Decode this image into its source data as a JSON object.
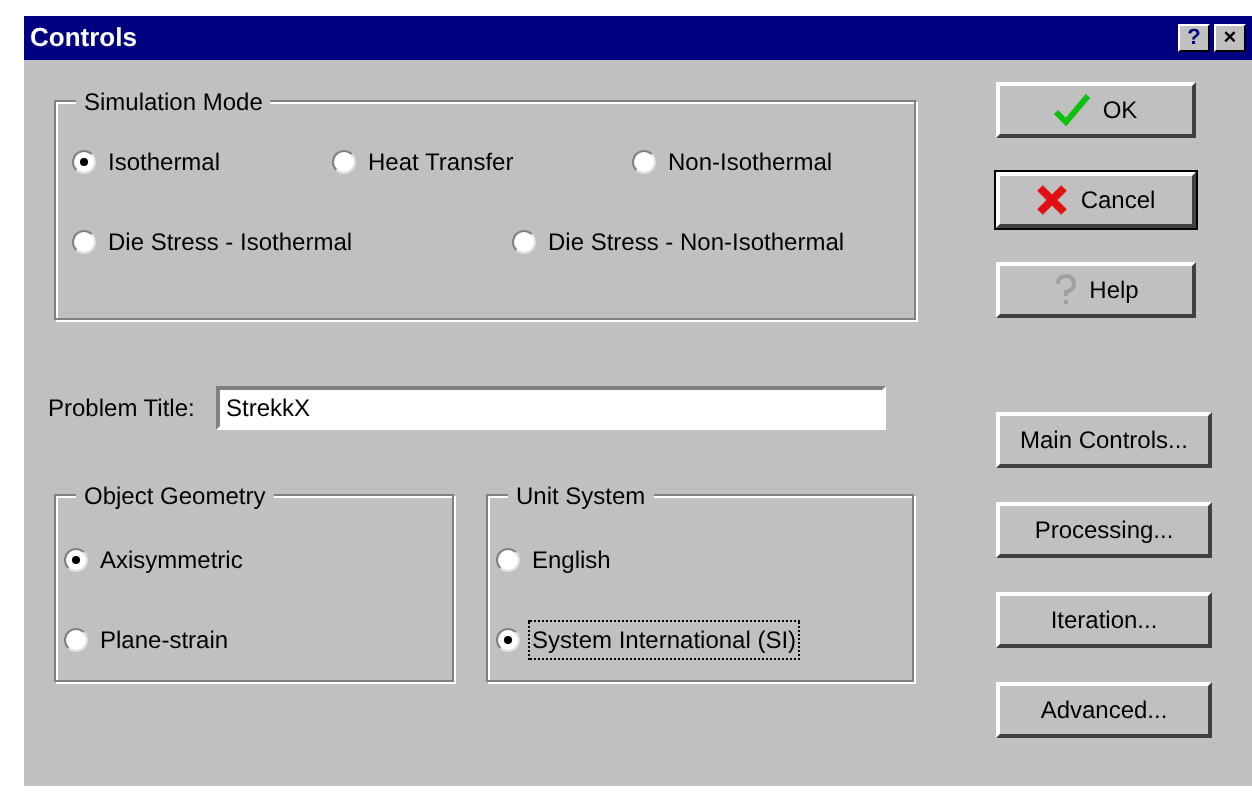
{
  "window": {
    "title": "Controls",
    "title_buttons": [
      "?",
      "×"
    ]
  },
  "simulation_mode": {
    "label": "Simulation Mode",
    "options": [
      {
        "label": "Isothermal",
        "selected": true
      },
      {
        "label": "Heat Transfer",
        "selected": false
      },
      {
        "label": "Non-Isothermal",
        "selected": false
      },
      {
        "label": "Die Stress - Isothermal",
        "selected": false
      },
      {
        "label": "Die Stress - Non-Isothermal",
        "selected": false
      }
    ]
  },
  "problem_title": {
    "label": "Problem Title:",
    "value": "StrekkX"
  },
  "object_geometry": {
    "label": "Object Geometry",
    "options": [
      {
        "label": "Axisymmetric",
        "selected": true,
        "focused": false
      },
      {
        "label": "Plane-strain",
        "selected": false,
        "focused": false
      }
    ]
  },
  "unit_system": {
    "label": "Unit System",
    "options": [
      {
        "label": "English",
        "selected": false,
        "focused": false
      },
      {
        "label": "System International (SI)",
        "selected": true,
        "focused": true
      }
    ]
  },
  "buttons": [
    {
      "label": "OK",
      "kind": "ok"
    },
    {
      "label": "Cancel",
      "kind": "cancel"
    },
    {
      "label": "Help",
      "kind": "help"
    },
    {
      "label": "Main Controls...",
      "kind": "plain"
    },
    {
      "label": "Processing...",
      "kind": "plain"
    },
    {
      "label": "Iteration...",
      "kind": "plain"
    },
    {
      "label": "Advanced...",
      "kind": "plain"
    }
  ]
}
